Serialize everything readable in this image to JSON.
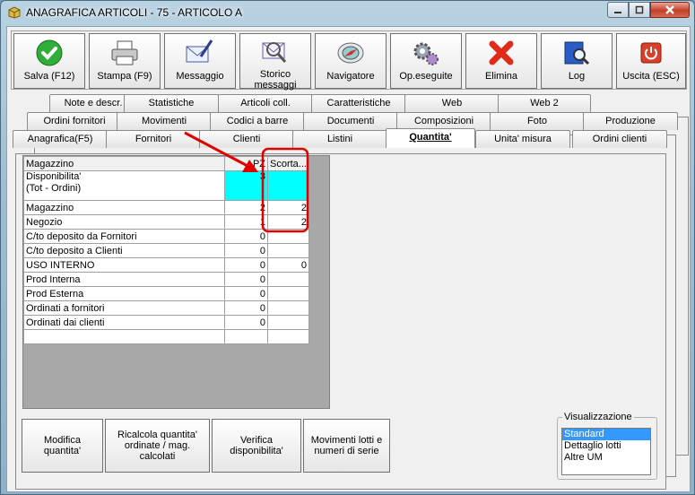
{
  "window": {
    "title": "ANAGRAFICA ARTICOLI - 75 - ARTICOLO A"
  },
  "toolbar": [
    {
      "label": "Salva (F12)",
      "icon": "checkmark-icon"
    },
    {
      "label": "Stampa (F9)",
      "icon": "printer-icon"
    },
    {
      "label": "Messaggio",
      "icon": "envelope-pen-icon"
    },
    {
      "label": "Storico\nmessaggi",
      "icon": "envelope-search-icon"
    },
    {
      "label": "Navigatore",
      "icon": "compass-icon"
    },
    {
      "label": "Op.eseguite",
      "icon": "gears-icon"
    },
    {
      "label": "Elimina",
      "icon": "red-x-icon"
    },
    {
      "label": "Log",
      "icon": "book-search-icon"
    },
    {
      "label": "Uscita (ESC)",
      "icon": "power-icon"
    }
  ],
  "tabs": {
    "row1": [
      "Note e descr.",
      "Statistiche",
      "Articoli coll.",
      "Caratteristiche",
      "Web",
      "Web 2"
    ],
    "row2": [
      "Ordini fornitori",
      "Movimenti",
      "Codici a barre",
      "Documenti",
      "Composizioni",
      "Foto",
      "Produzione"
    ],
    "row3": [
      "Anagrafica(F5)",
      "Fornitori",
      "Clienti",
      "Listini",
      "Quantita'",
      "Unita' misura",
      "Ordini clienti"
    ],
    "active": "Quantita'"
  },
  "grid": {
    "headers": [
      "Magazzino",
      "PZ",
      "Scorta..."
    ],
    "rows": [
      {
        "label": "Disponibilita'\n(Tot - Ordini)",
        "pz": "3",
        "scorta": ""
      },
      {
        "label": "Magazzino",
        "pz": "2",
        "scorta": "2"
      },
      {
        "label": "Negozio",
        "pz": "1",
        "scorta": "2"
      },
      {
        "label": "C/to deposito da Fornitori",
        "pz": "0",
        "scorta": ""
      },
      {
        "label": "C/to deposito a Clienti",
        "pz": "0",
        "scorta": ""
      },
      {
        "label": "USO INTERNO",
        "pz": "0",
        "scorta": "0"
      },
      {
        "label": "Prod Interna",
        "pz": "0",
        "scorta": ""
      },
      {
        "label": "Prod Esterna",
        "pz": "0",
        "scorta": ""
      },
      {
        "label": "Ordinati a fornitori",
        "pz": "0",
        "scorta": ""
      },
      {
        "label": "Ordinati dai clienti",
        "pz": "0",
        "scorta": ""
      },
      {
        "label": "",
        "pz": "",
        "scorta": ""
      }
    ]
  },
  "actions": [
    "Modifica\nquantita'",
    "Ricalcola quantita'\nordinate / mag.\ncalcolati",
    "Verifica\ndisponibilita'",
    "Movimenti lotti e\nnumeri di serie"
  ],
  "visualizzazione": {
    "title": "Visualizzazione",
    "options": [
      "Standard",
      "Dettaglio lotti",
      "Altre UM"
    ],
    "selected": "Standard"
  },
  "colors": {
    "highlight_cell": "#00ffff",
    "annotation": "#e00000",
    "selection": "#3399ff"
  }
}
